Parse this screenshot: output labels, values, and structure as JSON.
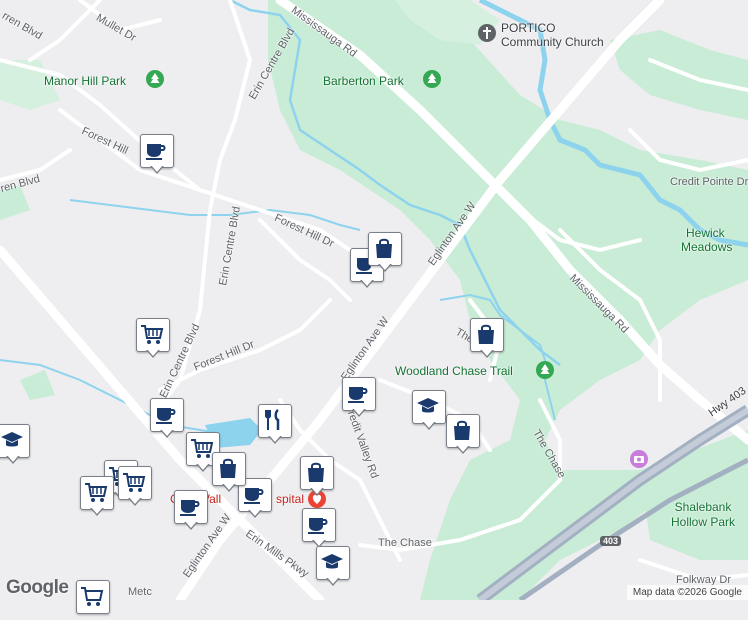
{
  "map": {
    "attribution": "Map data ©2026 Google",
    "logo": "Google",
    "colors": {
      "background": "#eeeef0",
      "park": "#c8ecd6",
      "water": "#8dd3ee",
      "road": "#ffffff",
      "highway": "#a3b0c2",
      "marker_icon": "#1a3a6e"
    }
  },
  "roads": {
    "mississauga_rd_top": "Mississauga Rd",
    "mississauga_rd_right": "Mississauga Rd",
    "erin_centre_top": "Erin Centre Blvd",
    "erin_centre_mid": "Erin Centre Blvd",
    "erin_centre_low": "Erin Centre Blvd",
    "forest_hill_1": "Forest Hill",
    "forest_hill_2": "Forest Hill Dr",
    "forest_hill_3": "Forest Hill Dr",
    "eglinton_1": "Eglinton Ave W",
    "eglinton_2": "Eglinton Ave W",
    "eglinton_3": "Eglinton Ave W",
    "credit_valley_rd": "Credit Valley Rd",
    "credit_pointe": "Credit Pointe Dr",
    "the_chase_1": "The Chase",
    "the_chase_2": "The Chase",
    "the_chase_3": "The",
    "erin_mills_pkwy": "Erin Mills Pkwy",
    "mullet_dr": "Mullet Dr",
    "folkway_dr": "Folkway Dr",
    "hwy_403": "Hwy 403",
    "hwy_shield": "403",
    "warren_blvd_top": "rren Blvd",
    "warren_blvd_left": "ren Blvd",
    "metcalfe_partial": "Metc"
  },
  "places": {
    "manor_hill_park": "Manor Hill Park",
    "barberton_park": "Barberton Park",
    "portico_line1": "PORTICO",
    "portico_line2": "Community Church",
    "hewick_line1": "Hewick",
    "hewick_line2": "Meadows",
    "woodland_chase": "Woodland Chase Trail",
    "shalebank": "Shalebank Hollow Park",
    "hospital": "Credit Valley Hospital",
    "hospital_partial_left": "C",
    "hospital_partial_mid": "Vall",
    "hospital_partial_right": "spital"
  }
}
